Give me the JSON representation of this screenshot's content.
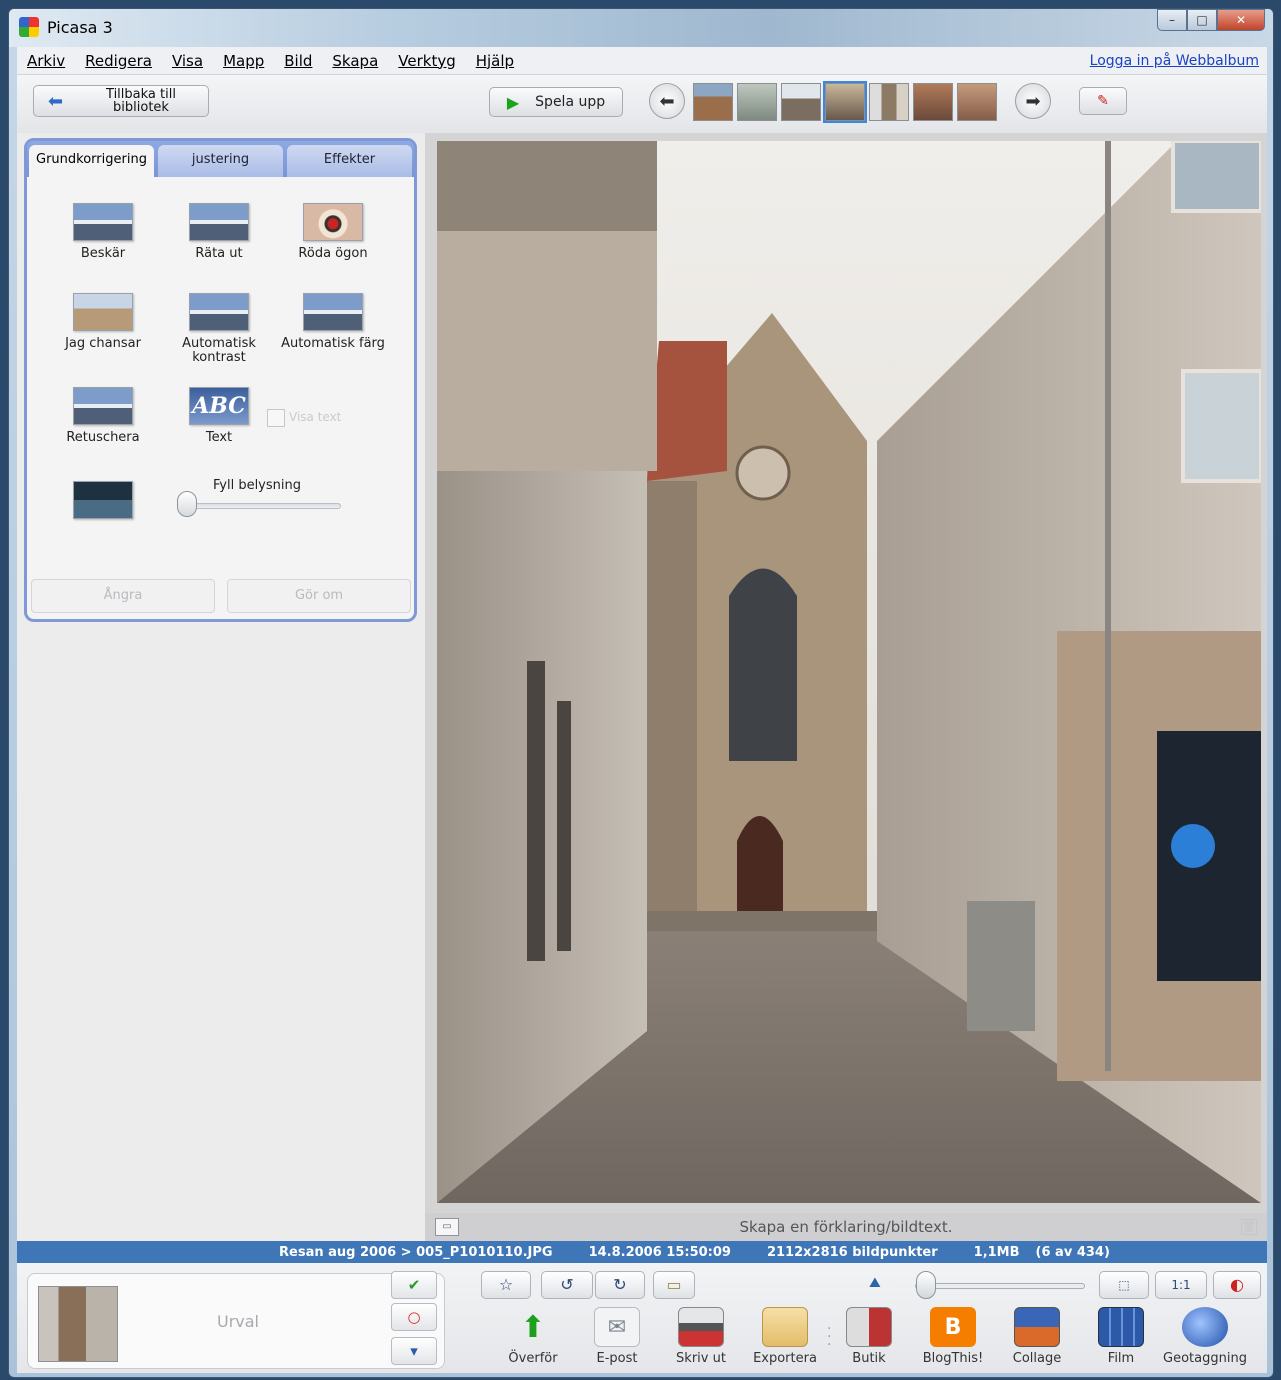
{
  "window": {
    "title": "Picasa 3",
    "min": "–",
    "max": "□",
    "close": "✕"
  },
  "menu": [
    "Arkiv",
    "Redigera",
    "Visa",
    "Mapp",
    "Bild",
    "Skapa",
    "Verktyg",
    "Hjälp"
  ],
  "login_link": "Logga in på Webbalbum",
  "toolbar": {
    "back_label": "Tillbaka till bibliotek",
    "back_icon": "⬅",
    "play_label": "Spela upp",
    "play_icon": "▶",
    "prev_icon": "⬅",
    "next_icon": "➡",
    "web_icon": "✎"
  },
  "tabs": [
    "Grundkorrigering",
    "justering",
    "Effekter"
  ],
  "tools": {
    "crop": "Beskär",
    "straighten": "Räta ut",
    "redeye": "Röda ögon",
    "feeling_lucky": "Jag chansar",
    "auto_contrast": "Automatisk kontrast",
    "auto_color": "Automatisk färg",
    "retouch": "Retuschera",
    "text": "Text",
    "text_icon": "ABC"
  },
  "show_text_label": "Visa text",
  "fill_light": {
    "label": "Fyll belysning",
    "value": 0.05
  },
  "undo_label": "Ångra",
  "redo_label": "Gör om",
  "caption": {
    "placeholder": "Skapa en förklaring/bildtext.",
    "icon": "▭",
    "trash_icon": "🗑"
  },
  "status": {
    "path": "Resan aug 2006 > 005_P1010110.JPG",
    "datetime": "14.8.2006 15:50:09",
    "dimensions": "2112x2816 bildpunkter",
    "size": "1,1MB",
    "position": "(6 av 434)"
  },
  "tray": {
    "label": "Urval",
    "pin_icon": "✔",
    "clear_icon": "○",
    "blog_icon": "▾"
  },
  "bottom_buttons": {
    "star": "☆",
    "rotate_left": "↺",
    "rotate_right": "↻",
    "tag": "▭",
    "zoom_icon": "⛰",
    "fit": "⬚",
    "actual": "1:1",
    "color": "◐"
  },
  "zoom": {
    "value": 0.05
  },
  "actions": [
    {
      "label": "Överför",
      "icon": "⬆"
    },
    {
      "label": "E-post",
      "icon": "✉"
    },
    {
      "label": "Skriv ut",
      "icon": ""
    },
    {
      "label": "Exportera",
      "icon": ""
    },
    {
      "label": "Butik",
      "icon": ""
    },
    {
      "label": "BlogThis!",
      "icon": "B"
    },
    {
      "label": "Collage",
      "icon": ""
    },
    {
      "label": "Film",
      "icon": ""
    },
    {
      "label": "Geotaggning",
      "icon": ""
    }
  ]
}
